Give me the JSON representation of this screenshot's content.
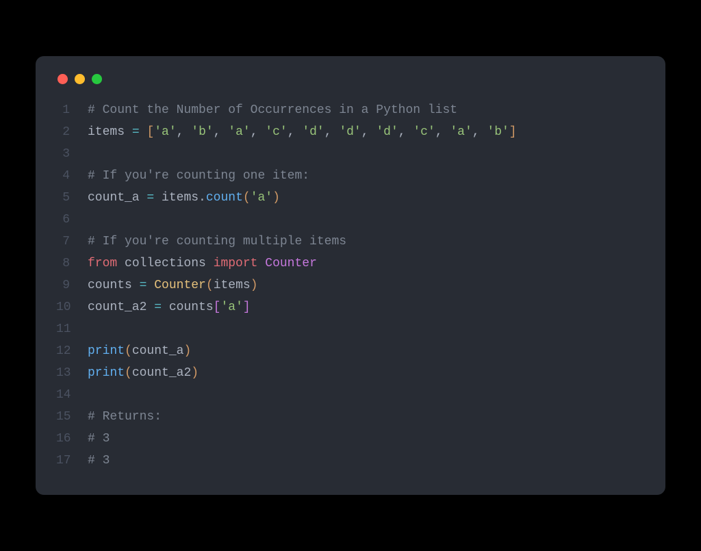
{
  "window": {
    "dots": [
      "red",
      "yellow",
      "green"
    ]
  },
  "code": {
    "lines": [
      {
        "n": "1",
        "tokens": [
          {
            "c": "c-comment",
            "t": "# Count the Number of Occurrences in a Python list"
          }
        ]
      },
      {
        "n": "2",
        "tokens": [
          {
            "c": "c-default",
            "t": "items "
          },
          {
            "c": "c-operator",
            "t": "="
          },
          {
            "c": "c-default",
            "t": " "
          },
          {
            "c": "c-paren",
            "t": "["
          },
          {
            "c": "c-string",
            "t": "'a'"
          },
          {
            "c": "c-default",
            "t": ", "
          },
          {
            "c": "c-string",
            "t": "'b'"
          },
          {
            "c": "c-default",
            "t": ", "
          },
          {
            "c": "c-string",
            "t": "'a'"
          },
          {
            "c": "c-default",
            "t": ", "
          },
          {
            "c": "c-string",
            "t": "'c'"
          },
          {
            "c": "c-default",
            "t": ", "
          },
          {
            "c": "c-string",
            "t": "'d'"
          },
          {
            "c": "c-default",
            "t": ", "
          },
          {
            "c": "c-string",
            "t": "'d'"
          },
          {
            "c": "c-default",
            "t": ", "
          },
          {
            "c": "c-string",
            "t": "'d'"
          },
          {
            "c": "c-default",
            "t": ", "
          },
          {
            "c": "c-string",
            "t": "'c'"
          },
          {
            "c": "c-default",
            "t": ", "
          },
          {
            "c": "c-string",
            "t": "'a'"
          },
          {
            "c": "c-default",
            "t": ", "
          },
          {
            "c": "c-string",
            "t": "'b'"
          },
          {
            "c": "c-paren",
            "t": "]"
          }
        ]
      },
      {
        "n": "3",
        "tokens": []
      },
      {
        "n": "4",
        "tokens": [
          {
            "c": "c-comment",
            "t": "# If you're counting one item:"
          }
        ]
      },
      {
        "n": "5",
        "tokens": [
          {
            "c": "c-default",
            "t": "count_a "
          },
          {
            "c": "c-operator",
            "t": "="
          },
          {
            "c": "c-default",
            "t": " items."
          },
          {
            "c": "c-func",
            "t": "count"
          },
          {
            "c": "c-paren",
            "t": "("
          },
          {
            "c": "c-string",
            "t": "'a'"
          },
          {
            "c": "c-paren",
            "t": ")"
          }
        ]
      },
      {
        "n": "6",
        "tokens": []
      },
      {
        "n": "7",
        "tokens": [
          {
            "c": "c-comment",
            "t": "# If you're counting multiple items"
          }
        ]
      },
      {
        "n": "8",
        "tokens": [
          {
            "c": "c-red",
            "t": "from"
          },
          {
            "c": "c-default",
            "t": " collections "
          },
          {
            "c": "c-red",
            "t": "import"
          },
          {
            "c": "c-default",
            "t": " "
          },
          {
            "c": "c-keyword",
            "t": "Counter"
          }
        ]
      },
      {
        "n": "9",
        "tokens": [
          {
            "c": "c-default",
            "t": "counts "
          },
          {
            "c": "c-operator",
            "t": "="
          },
          {
            "c": "c-default",
            "t": " "
          },
          {
            "c": "c-class",
            "t": "Counter"
          },
          {
            "c": "c-paren",
            "t": "("
          },
          {
            "c": "c-default",
            "t": "items"
          },
          {
            "c": "c-paren",
            "t": ")"
          }
        ]
      },
      {
        "n": "10",
        "tokens": [
          {
            "c": "c-default",
            "t": "count_a2 "
          },
          {
            "c": "c-operator",
            "t": "="
          },
          {
            "c": "c-default",
            "t": " counts"
          },
          {
            "c": "c-bracket",
            "t": "["
          },
          {
            "c": "c-string",
            "t": "'a'"
          },
          {
            "c": "c-bracket",
            "t": "]"
          }
        ]
      },
      {
        "n": "11",
        "tokens": []
      },
      {
        "n": "12",
        "tokens": [
          {
            "c": "c-func",
            "t": "print"
          },
          {
            "c": "c-paren",
            "t": "("
          },
          {
            "c": "c-default",
            "t": "count_a"
          },
          {
            "c": "c-paren",
            "t": ")"
          }
        ]
      },
      {
        "n": "13",
        "tokens": [
          {
            "c": "c-func",
            "t": "print"
          },
          {
            "c": "c-paren",
            "t": "("
          },
          {
            "c": "c-default",
            "t": "count_a2"
          },
          {
            "c": "c-paren",
            "t": ")"
          }
        ]
      },
      {
        "n": "14",
        "tokens": []
      },
      {
        "n": "15",
        "tokens": [
          {
            "c": "c-comment",
            "t": "# Returns:"
          }
        ]
      },
      {
        "n": "16",
        "tokens": [
          {
            "c": "c-comment",
            "t": "# 3"
          }
        ]
      },
      {
        "n": "17",
        "tokens": [
          {
            "c": "c-comment",
            "t": "# 3"
          }
        ]
      }
    ]
  }
}
